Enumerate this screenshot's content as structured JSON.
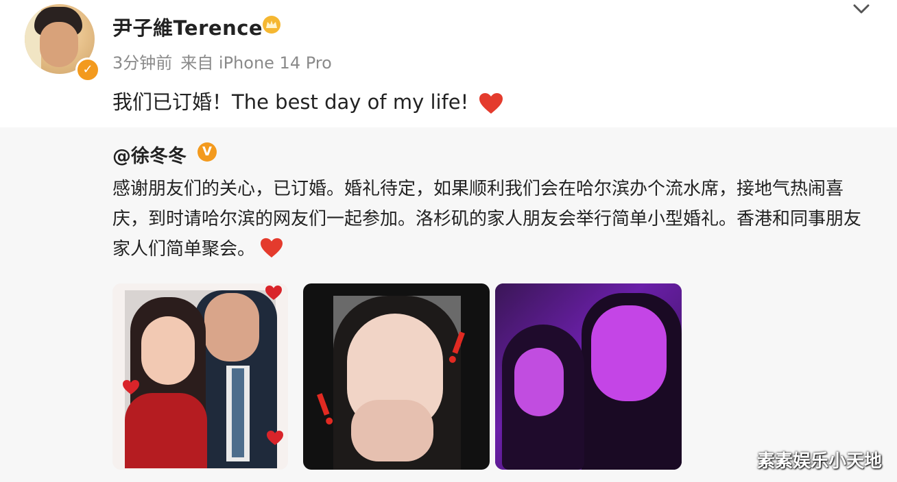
{
  "post": {
    "username": "尹子維Terence",
    "time": "3分钟前",
    "source": "来自 iPhone 14 Pro",
    "text": "我们已订婚！The best day of my life!"
  },
  "repost": {
    "author": "@徐冬冬",
    "text": "感谢朋友们的关心，已订婚。婚礼待定，如果顺利我们会在哈尔滨办个流水席，接地气热闹喜庆，到时请哈尔滨的网友们一起参加。洛杉矶的家人朋友会举行简单小型婚礼。香港和同事朋友家人们简单聚会。"
  },
  "watermark": "素素娱乐小天地",
  "colors": {
    "verify": "#f39a1e",
    "heart": "#e43b2d",
    "repost_bg": "#f7f7f7"
  },
  "icons": {
    "crown": "crown-icon",
    "heart": "heart-icon",
    "chevron": "chevron-down-icon",
    "verify": "verified-badge-icon"
  }
}
